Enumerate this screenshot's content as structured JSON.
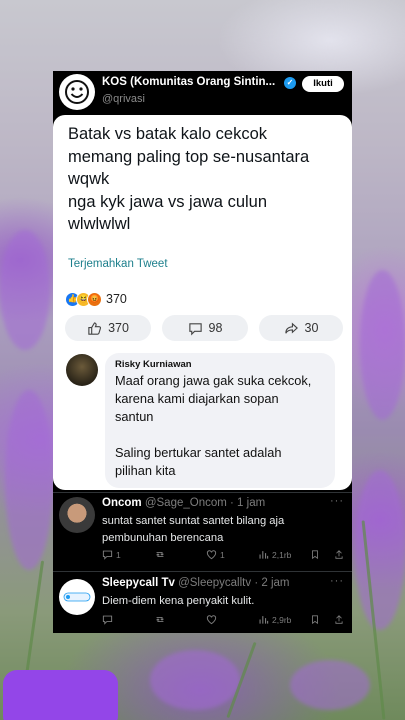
{
  "post": {
    "author_name": "KOS (Komunitas Orang Sintin...",
    "handle": "@qrivasi",
    "follow_label": "Ikuti",
    "text": "Batak vs batak kalo cekcok\nmemang paling top se-nusantara\nwqwk\nnga kyk jawa vs jawa culun\nwlwlwlwl",
    "translate_label": "Terjemahkan Tweet",
    "reaction_count": "370",
    "like_count": "370",
    "comment_count": "98",
    "share_count": "30"
  },
  "top_reply": {
    "author": "Risky Kurniawan",
    "text": "Maaf orang jawa gak suka cekcok,\nkarena kami diajarkan sopan\nsantun\n\nSaling bertukar santet adalah\npilihan kita"
  },
  "comments": [
    {
      "name": "Oncom",
      "handle": "@Sage_Oncom",
      "time": "· 1 jam",
      "text": "suntat santet suntat santet bilang aja\npembunuhan berencana",
      "replies": "1",
      "likes": "1",
      "views": "2,1rb"
    },
    {
      "name": "Sleepycall Tv",
      "handle": "@Sleepycalltv",
      "time": "· 2 jam",
      "text": "Diem-diem kena penyakit kulit.",
      "views": "2,9rb"
    }
  ],
  "colors": {
    "accent_blue": "#1d9bf0",
    "translate_teal": "#1d7f8c",
    "purple_tab": "#9346e8"
  }
}
